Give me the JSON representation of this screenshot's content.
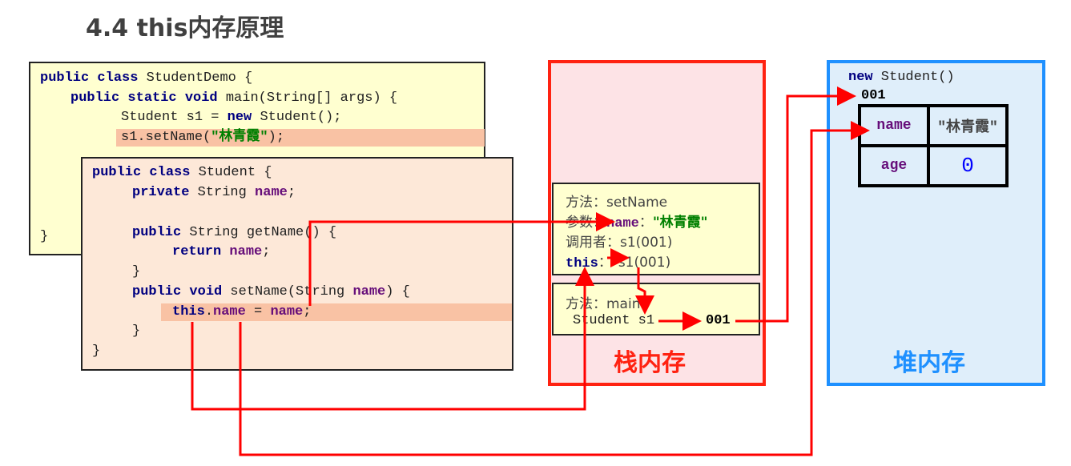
{
  "title": "4.4 this内存原理",
  "demo_code": [
    [
      [
        "kw",
        "public class "
      ],
      [
        "p",
        "StudentDemo {"
      ]
    ],
    [
      [
        "kw",
        "public static void "
      ],
      [
        "p",
        "main(String[] args) {"
      ]
    ],
    [
      [
        "p",
        "Student s1 = "
      ],
      [
        "kw",
        "new "
      ],
      [
        "p",
        "Student();"
      ]
    ],
    [
      [
        "p",
        "s1.setName("
      ],
      [
        "str",
        "\"林青霞\""
      ],
      [
        "p",
        ");"
      ]
    ],
    [
      [
        "p",
        "}"
      ]
    ]
  ],
  "student_code": [
    [
      [
        "kw",
        "public class "
      ],
      [
        "p",
        "Student {"
      ]
    ],
    [
      [
        "kw",
        "private "
      ],
      [
        "p",
        "String "
      ],
      [
        "id",
        "name"
      ],
      [
        "p",
        ";"
      ]
    ],
    [
      [
        "kw",
        "public "
      ],
      [
        "p",
        "String getName() {"
      ]
    ],
    [
      [
        "kw",
        "return "
      ],
      [
        "id",
        "name"
      ],
      [
        "p",
        ";"
      ]
    ],
    [
      [
        "p",
        "}"
      ]
    ],
    [
      [
        "kw",
        "public void "
      ],
      [
        "p",
        "setName(String "
      ],
      [
        "id",
        "name"
      ],
      [
        "p",
        ") {"
      ]
    ],
    [
      [
        "kw",
        "this"
      ],
      [
        "p",
        "."
      ],
      [
        "id",
        "name"
      ],
      [
        "p",
        " = "
      ],
      [
        "id",
        "name"
      ],
      [
        "p",
        ";"
      ]
    ],
    [
      [
        "p",
        "}"
      ]
    ],
    [
      [
        "p",
        "}"
      ]
    ]
  ],
  "stack": {
    "label": "栈内存",
    "setName_frame": {
      "method": "方法：setName",
      "param_label": "参数：",
      "param_name": "name",
      "param_sep": "：",
      "param_value": "\"林青霞\"",
      "caller": "调用者：s1(001)",
      "this_kw": "this",
      "this_sep": "：",
      "this_value": "s1(001)"
    },
    "main_frame": {
      "method": "方法：main",
      "var": "Student s1",
      "ref": "001"
    }
  },
  "heap": {
    "label": "堆内存",
    "new_kw": "new",
    "new_rest": " Student()",
    "address": "001",
    "fields": [
      {
        "name": "name",
        "value": "\"林青霞\""
      },
      {
        "name": "age",
        "value": "0"
      }
    ]
  },
  "colors": {
    "stack_border": "#ff2211",
    "heap_border": "#1e90ff",
    "arrow": "#ff0000"
  }
}
